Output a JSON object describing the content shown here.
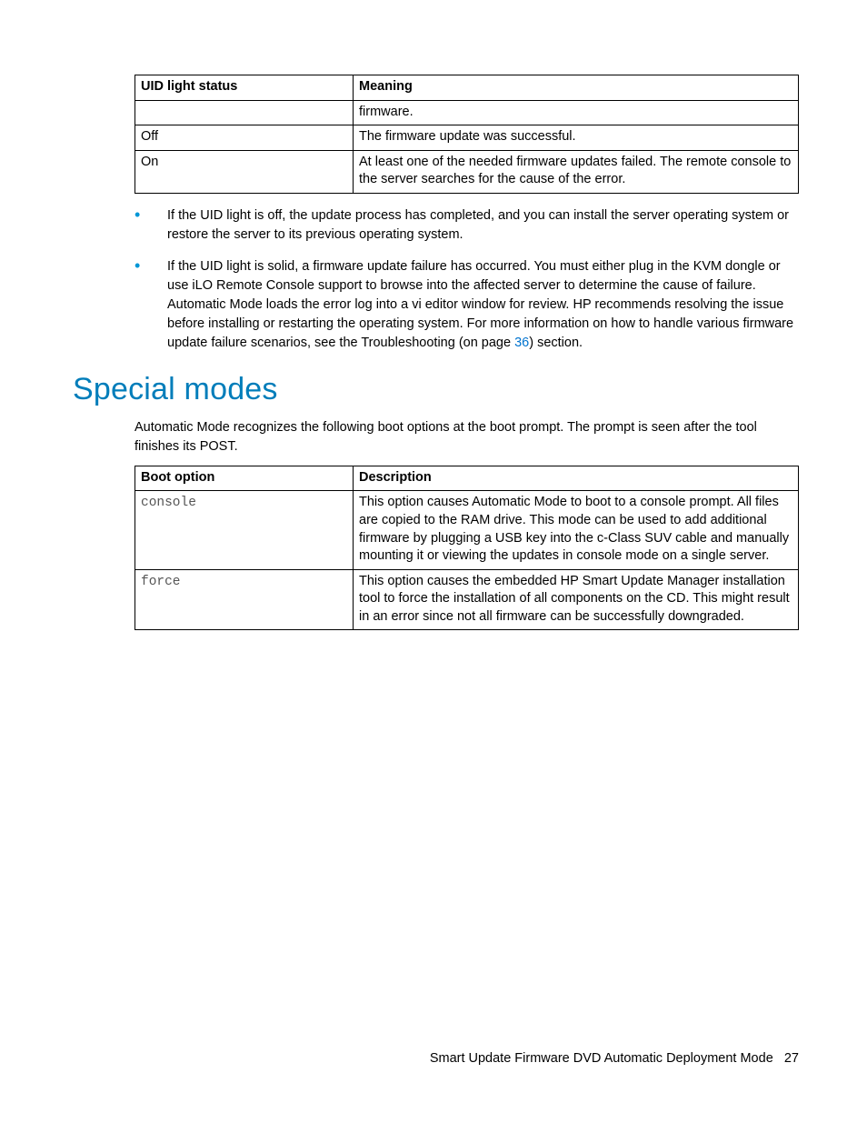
{
  "table1": {
    "headers": [
      "UID light status",
      "Meaning"
    ],
    "rows": [
      {
        "c1": "",
        "c2": "firmware."
      },
      {
        "c1": "Off",
        "c2": "The firmware update was successful."
      },
      {
        "c1": "On",
        "c2": "At least one of the needed firmware updates failed. The remote console to the server searches for the cause of the error."
      }
    ]
  },
  "bullets": {
    "b1": "If the UID light is off, the update process has completed, and you can install the server operating system or restore the server to its previous operating system.",
    "b2_pre": "If the UID light is solid, a firmware update failure has occurred. You must either plug in the KVM dongle or use iLO Remote Console support to browse into the affected server to determine the cause of failure. Automatic Mode loads the error log into a vi editor window for review. HP recommends resolving the issue before installing or restarting the operating system. For more information on how to handle various firmware update failure scenarios, see the Troubleshooting (on page ",
    "b2_link": "36",
    "b2_post": ") section."
  },
  "heading": "Special modes",
  "intro": "Automatic Mode recognizes the following boot options at the boot prompt. The prompt is seen after the tool finishes its POST.",
  "table2": {
    "headers": [
      "Boot option",
      "Description"
    ],
    "rows": [
      {
        "c1": "console",
        "c2": "This option causes Automatic Mode to boot to a console prompt. All files are copied to the RAM drive. This mode can be used to add additional firmware by plugging a USB key into the c-Class SUV cable and manually mounting it or viewing the updates in console mode on a single server."
      },
      {
        "c1": "force",
        "c2": "This option causes the embedded HP Smart Update Manager installation tool to force the installation of all components on the CD. This might result in an error since not all firmware can be successfully downgraded."
      }
    ]
  },
  "footer": {
    "title": "Smart Update Firmware DVD Automatic Deployment Mode",
    "page": "27"
  }
}
